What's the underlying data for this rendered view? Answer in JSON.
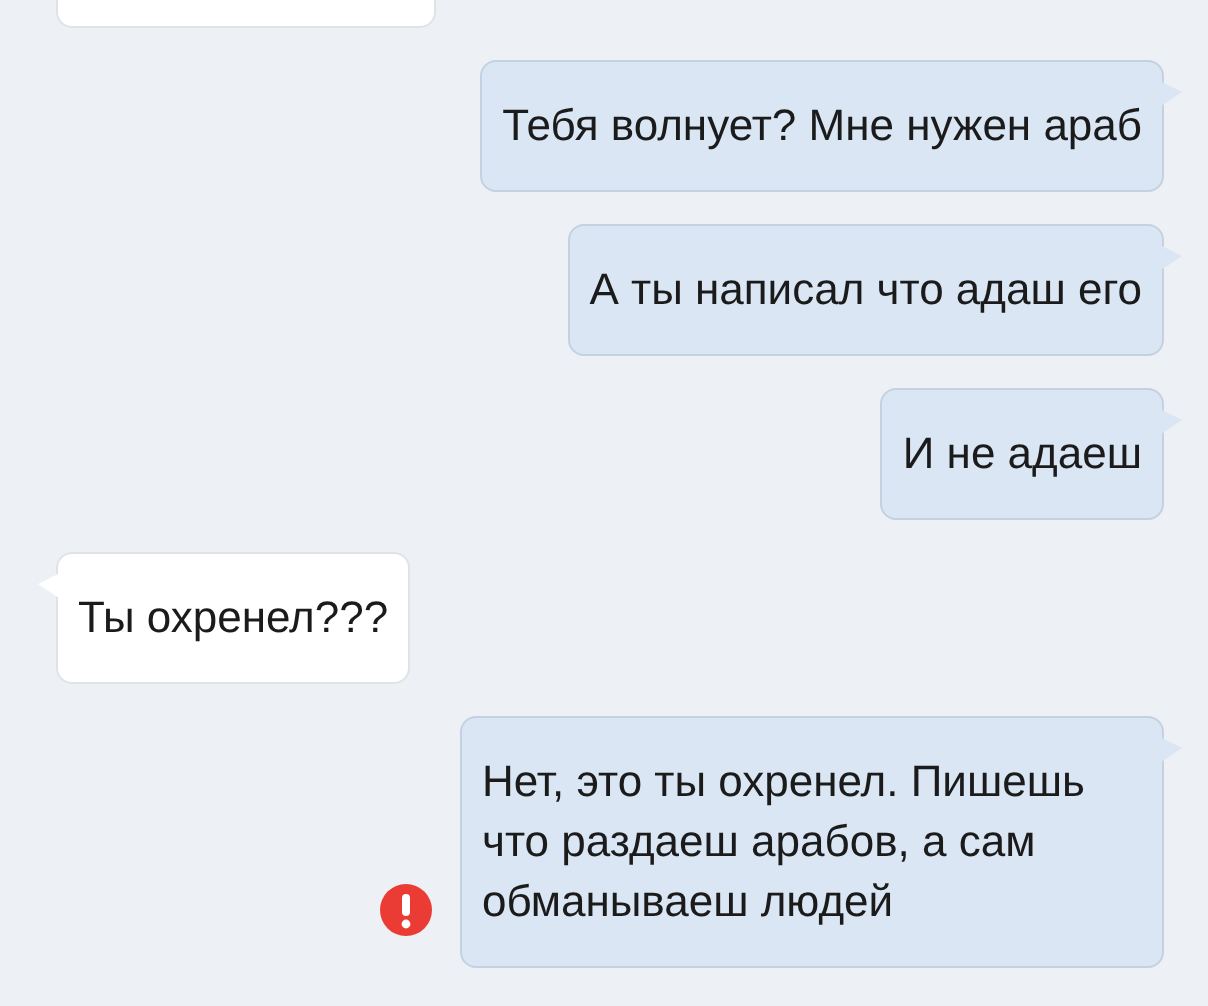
{
  "messages": [
    {
      "kind": "incoming",
      "cut_off": true
    },
    {
      "kind": "outgoing",
      "text": "Тебя волнует? Мне нужен араб"
    },
    {
      "kind": "outgoing",
      "text": "А ты написал что адаш его"
    },
    {
      "kind": "outgoing",
      "text": "И не адаеш"
    },
    {
      "kind": "incoming",
      "text": "Ты охренел???"
    },
    {
      "kind": "outgoing",
      "text": "Нет, это ты охренел. Пишешь что раздаеш арабов, а сам обманываеш людей",
      "error": true
    }
  ]
}
